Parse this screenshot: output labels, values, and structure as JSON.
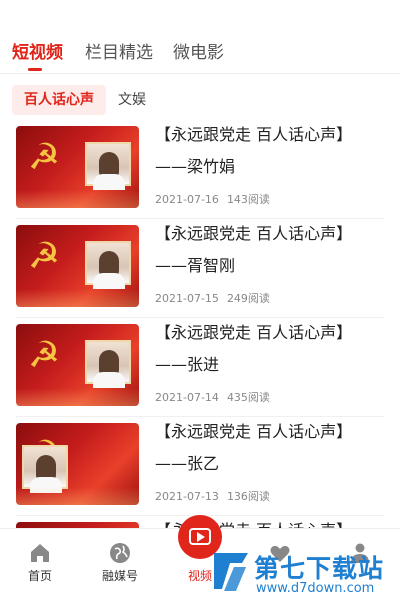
{
  "top_tabs": [
    {
      "label": "短视频",
      "active": true
    },
    {
      "label": "栏目精选",
      "active": false
    },
    {
      "label": "微电影",
      "active": false
    }
  ],
  "sub_tabs": [
    {
      "label": "百人话心声",
      "active": true
    },
    {
      "label": "文娱",
      "active": false
    }
  ],
  "items": [
    {
      "title_line1": "【永远跟党走 百人话心声】",
      "title_line2": "——梁竹娟",
      "date": "2021-07-16",
      "reads": "143阅读"
    },
    {
      "title_line1": "【永远跟党走 百人话心声】",
      "title_line2": "——胥智刚",
      "date": "2021-07-15",
      "reads": "249阅读"
    },
    {
      "title_line1": "【永远跟党走 百人话心声】",
      "title_line2": "——张进",
      "date": "2021-07-14",
      "reads": "435阅读"
    },
    {
      "title_line1": "【永远跟党走 百人话心声】",
      "title_line2": "——张乙",
      "date": "2021-07-13",
      "reads": "136阅读"
    },
    {
      "title_line1": "【永远跟党走 百人话心声】",
      "title_line2": "",
      "date": "",
      "reads": ""
    }
  ],
  "bottom_nav": [
    {
      "label": "首页",
      "icon": "home-icon",
      "active": false
    },
    {
      "label": "融媒号",
      "icon": "globe-icon",
      "active": false
    },
    {
      "label": "视频",
      "icon": "video-play-icon",
      "active": true
    },
    {
      "label": "",
      "icon": "heart-icon",
      "active": false
    },
    {
      "label": "",
      "icon": "user-icon",
      "active": false
    }
  ],
  "watermark": {
    "name": "第七下载站",
    "url": "www.d7down.com"
  },
  "colors": {
    "accent": "#e0251b",
    "watermark_blue": "#1f7fd0"
  }
}
